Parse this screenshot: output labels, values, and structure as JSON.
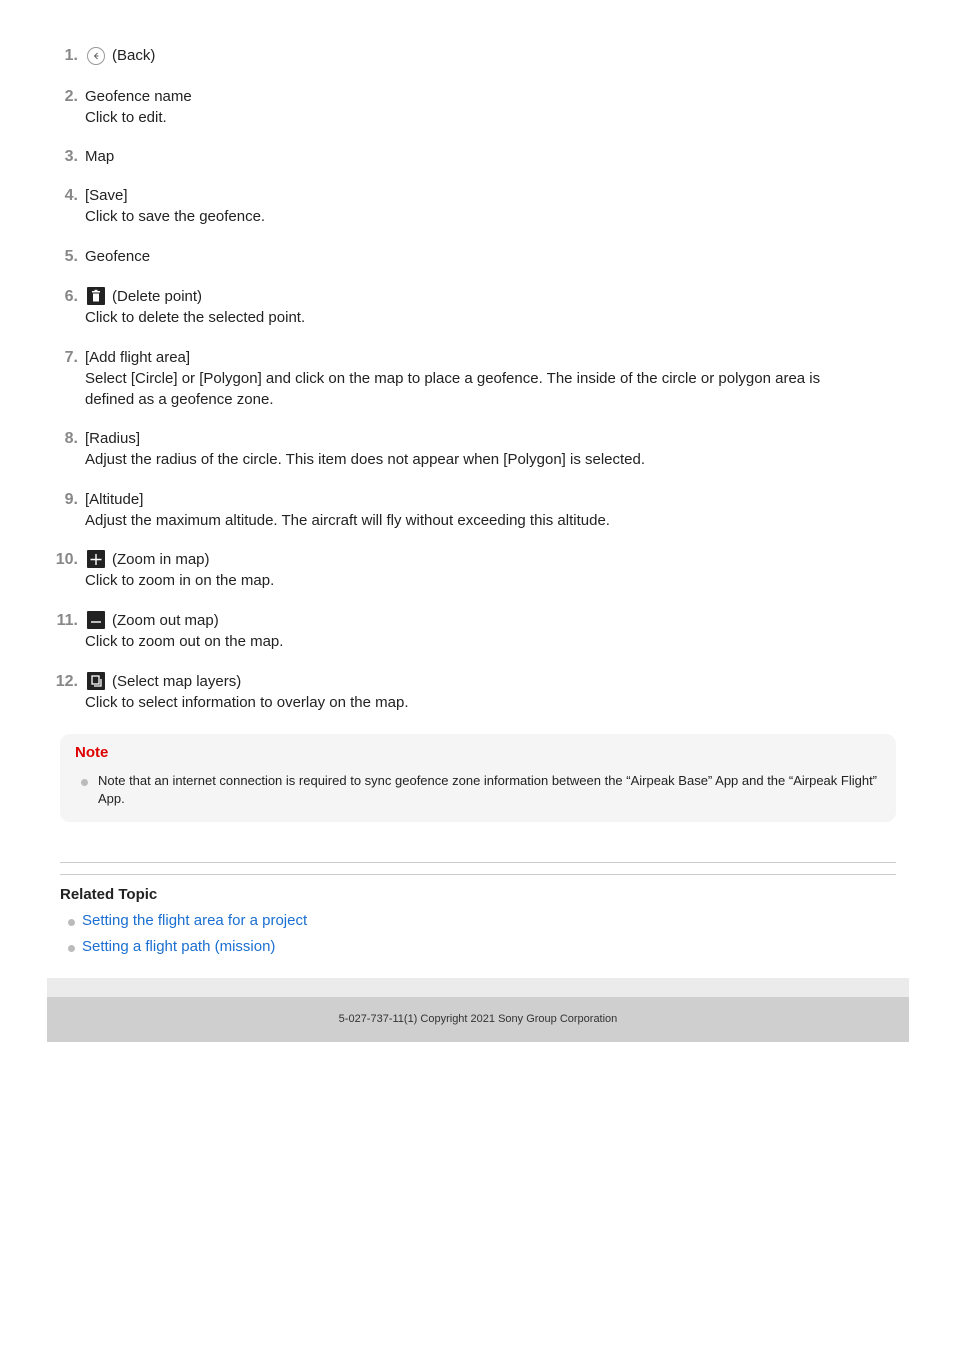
{
  "items": [
    {
      "n": "1.",
      "title": "(Back)",
      "icon": "back-arrow-icon",
      "desc": ""
    },
    {
      "n": "2.",
      "title": "Geofence name",
      "desc": "Click to edit."
    },
    {
      "n": "3.",
      "title": "Map",
      "desc": ""
    },
    {
      "n": "4.",
      "title": "[Save]",
      "desc": "Click to save the geofence."
    },
    {
      "n": "5.",
      "title": "Geofence",
      "desc": ""
    },
    {
      "n": "6.",
      "title": "(Delete point)",
      "icon": "trash-icon",
      "desc": "Click to delete the selected point."
    },
    {
      "n": "7.",
      "title": "[Add flight area]",
      "desc": "Select [Circle] or [Polygon] and click on the map to place a geofence. The inside of the circle or polygon area is defined as a geofence zone."
    },
    {
      "n": "8.",
      "title": "[Radius]",
      "desc": "Adjust the radius of the circle. This item does not appear when [Polygon] is selected."
    },
    {
      "n": "9.",
      "title": "[Altitude]",
      "desc": "Adjust the maximum altitude. The aircraft will fly without exceeding this altitude."
    },
    {
      "n": "10.",
      "title": "(Zoom in map)",
      "icon": "plus-icon",
      "desc": "Click to zoom in on the map."
    },
    {
      "n": "11.",
      "title": "(Zoom out map)",
      "icon": "minus-icon",
      "desc": "Click to zoom out on the map."
    },
    {
      "n": "12.",
      "title": "(Select map layers)",
      "icon": "layers-icon",
      "desc": "Click to select information to overlay on the map."
    }
  ],
  "note": {
    "title": "Note",
    "text": "Note that an internet connection is required to sync geofence zone information between the “Airpeak Base” App and the “Airpeak Flight” App."
  },
  "related": {
    "title": "Related Topic",
    "links": [
      "Setting the flight area for a project",
      "Setting a flight path (mission)"
    ]
  },
  "footer": {
    "copyright": "5-027-737-11(1) Copyright 2021 Sony Group Corporation"
  }
}
